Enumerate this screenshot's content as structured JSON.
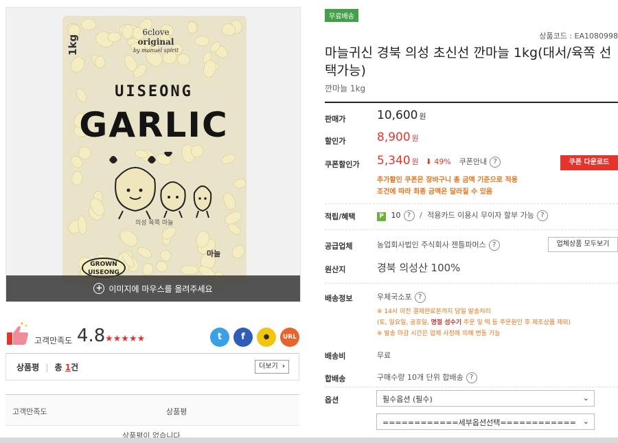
{
  "image": {
    "bag_brand_line1": "6clove",
    "bag_brand_line2": "original",
    "bag_brand_line3": "by manuel spirit",
    "bag_uiseong": "UISEONG",
    "bag_garlic": "GARLIC",
    "bag_weight": "1kg",
    "bag_grown_line1": "GROWN",
    "bag_grown_line2": "UISEONG",
    "bag_subtext": "의성 육쪽 마늘",
    "bag_side_text": "마늘",
    "overlay_text": "이미지에 마우스를 올려주세요"
  },
  "rating": {
    "label": "고객만족도",
    "score": "4.8",
    "stars": "★★★★★"
  },
  "share": {
    "twitter": "t",
    "facebook": "f",
    "kakao": "●",
    "url": "URL"
  },
  "reviews": {
    "title": "상품평",
    "separator": "|",
    "total_prefix": "총",
    "total_count": "1",
    "total_suffix": "건",
    "more_label": "더보기",
    "col_satisfaction": "고객만족도",
    "col_review": "상품평",
    "empty": "상품평이 없습니다."
  },
  "product": {
    "free_shipping_badge": "무료배송",
    "code": "상품코드 : EA1080998",
    "title": "마늘귀신 경북 의성 초신선 깐마늘 1kg(대서/육쪽 선택가능)",
    "subtitle": "깐마늘 1kg"
  },
  "price": {
    "sale_label": "판매가",
    "sale_value": "10,600",
    "discount_label": "할인가",
    "discount_value": "8,900",
    "coupon_label": "쿠폰할인가",
    "coupon_value": "5,340",
    "coupon_rate": "49%",
    "coupon_guide": "쿠폰안내",
    "won": "원",
    "coupon_download": "쿠폰 다운로드",
    "coupon_note_line1": "추가할인 쿠폰은 장바구니 총 금액 기준으로 적용",
    "coupon_note_line2": "조건에 따라 최종 금액은 달라질 수 있음"
  },
  "benefits": {
    "label": "적립/혜택",
    "points_badge": "P",
    "points": "10",
    "slash": "/",
    "card_text": "적용카드 이용시 무이자 할부 가능"
  },
  "supplier": {
    "label": "공급업체",
    "name": "농업회사법인 주식회사 젠틀파머스",
    "vendor_button": "업체상품 모두보기"
  },
  "origin": {
    "label": "원산지",
    "value": "경북 의성산 100%"
  },
  "shipping": {
    "label": "배송정보",
    "carrier": "우체국소포",
    "note1": "※ 14시 이전 결제완료분까지 당일 발송처리",
    "note2_pre": "(토, 일요일, 공휴일, ",
    "note2_bold": "명절 성수기",
    "note2_post": " 주문 및 떡 등 주문원인 후 제조상품 제외)",
    "note3": "※ 발송 마감 시간은 업체 사정에 의해 변동 가능"
  },
  "shipping_fee": {
    "label": "배송비",
    "value": "무료"
  },
  "bundle": {
    "label": "합배송",
    "value": "구매수량 10개 단위 합배송"
  },
  "options": {
    "label": "옵션",
    "select1": "필수옵션 (필수)",
    "select2": "============세부옵션선택============"
  },
  "colors": {
    "accent_red": "#e5342c",
    "orange_note": "#e8741a",
    "free_badge_green": "#43a047",
    "twitter": "#3aa1e6",
    "facebook": "#2e5cb8",
    "kakao": "#f2c511",
    "url": "#e8642c"
  }
}
